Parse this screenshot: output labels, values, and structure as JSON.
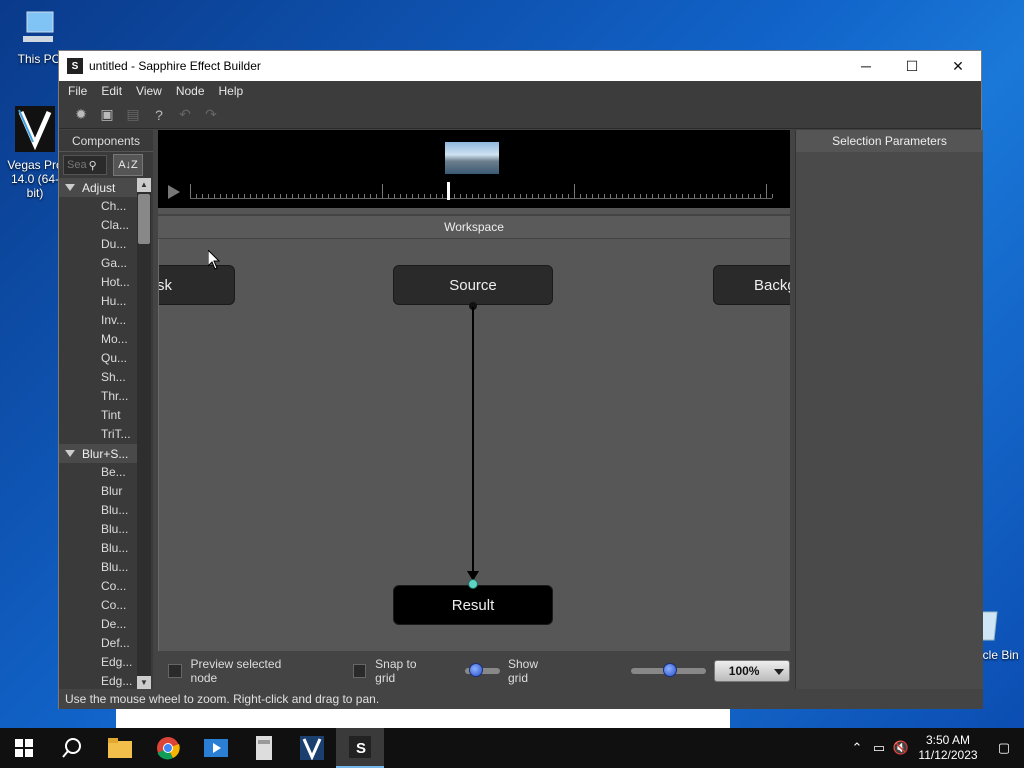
{
  "desktop": {
    "icons": [
      {
        "label": "This PC"
      },
      {
        "label": "Vegas Pro 14.0 (64-bit)"
      },
      {
        "label": "Recycle Bin"
      }
    ]
  },
  "window": {
    "title": "untitled - Sapphire Effect Builder",
    "app_icon_text": "S",
    "controls": {
      "minimize": "─",
      "maximize": "☐",
      "close": "✕"
    }
  },
  "menu": [
    "File",
    "Edit",
    "View",
    "Node",
    "Help"
  ],
  "components": {
    "header": "Components",
    "search_placeholder": "Sea",
    "sort_label": "A↓Z",
    "categories": [
      {
        "name": "Adjust",
        "items": [
          "Ch...",
          "Cla...",
          "Du...",
          "Ga...",
          "Hot...",
          "Hu...",
          "Inv...",
          "Mo...",
          "Qu...",
          "Sh...",
          "Thr...",
          "Tint",
          "TriT..."
        ]
      },
      {
        "name": "Blur+S...",
        "items": [
          "Be...",
          "Blur",
          "Blu...",
          "Blu...",
          "Blu...",
          "Blu...",
          "Co...",
          "Co...",
          "De...",
          "Def...",
          "Edg...",
          "Edg..."
        ]
      }
    ]
  },
  "workspace": {
    "header": "Workspace",
    "nodes": {
      "left_partial": "sk",
      "source": "Source",
      "right_partial": "Backg",
      "result": "Result"
    }
  },
  "bottom": {
    "preview_selected_node": "Preview selected node",
    "snap_to_grid": "Snap to grid",
    "show_grid": "Show grid",
    "zoom": "100%",
    "grid_slider_level": 0.15,
    "zoom_slider_level": 0.5
  },
  "selection_parameters": {
    "header": "Selection Parameters"
  },
  "status": "Use the mouse wheel to zoom.  Right-click and drag to pan.",
  "taskbar": {
    "time": "3:50 AM",
    "date": "11/12/2023"
  }
}
